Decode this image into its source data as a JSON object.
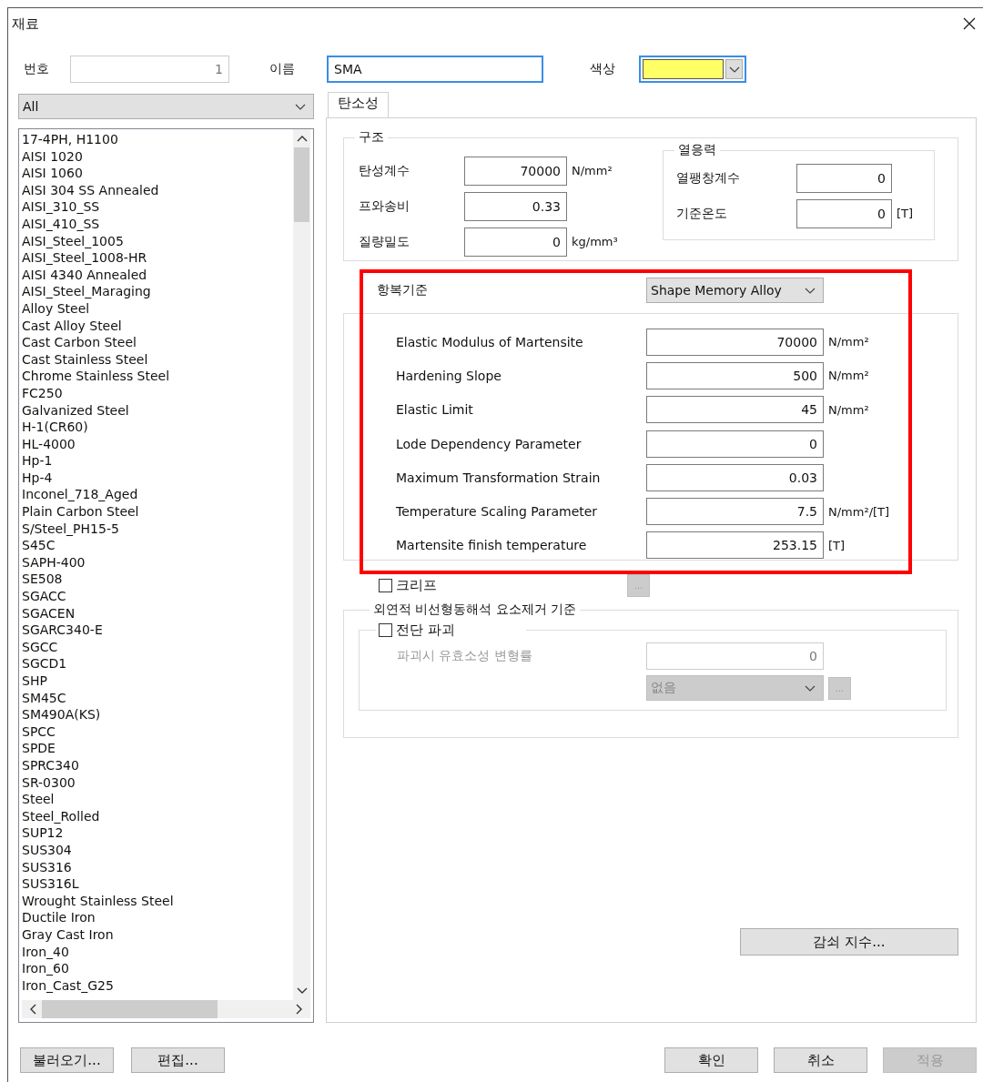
{
  "window": {
    "title": "재료"
  },
  "header": {
    "number": {
      "label": "번호",
      "value": "1",
      "disabled": true
    },
    "name": {
      "label": "이름",
      "value": "SMA",
      "focused": true
    },
    "color": {
      "label": "색상",
      "color": "#ffff66",
      "focused": true
    }
  },
  "filter": {
    "value": "All"
  },
  "materials": [
    {
      "label": "17-4PH, H1100",
      "selected": false
    },
    {
      "label": "AISI 1020",
      "selected": false
    },
    {
      "label": "AISI 1060",
      "selected": false
    },
    {
      "label": "AISI 304 SS Annealed",
      "selected": false
    },
    {
      "label": "AISI_310_SS",
      "selected": false
    },
    {
      "label": "AISI_410_SS",
      "selected": false
    },
    {
      "label": "AISI_Steel_1005",
      "selected": false
    },
    {
      "label": "AISI_Steel_1008-HR",
      "selected": false
    },
    {
      "label": "AISI 4340 Annealed",
      "selected": false
    },
    {
      "label": "AISI_Steel_Maraging",
      "selected": false
    },
    {
      "label": "Alloy Steel",
      "selected": false
    },
    {
      "label": "Cast Alloy Steel",
      "selected": false
    },
    {
      "label": "Cast Carbon Steel",
      "selected": false
    },
    {
      "label": "Cast Stainless Steel",
      "selected": false
    },
    {
      "label": "Chrome Stainless Steel",
      "selected": false
    },
    {
      "label": "FC250",
      "selected": false
    },
    {
      "label": "Galvanized Steel",
      "selected": false
    },
    {
      "label": "H-1(CR60)",
      "selected": false
    },
    {
      "label": "HL-4000",
      "selected": false
    },
    {
      "label": "Hp-1",
      "selected": false
    },
    {
      "label": "Hp-4",
      "selected": false
    },
    {
      "label": "Inconel_718_Aged",
      "selected": false
    },
    {
      "label": "Plain Carbon Steel",
      "selected": false
    },
    {
      "label": "S/Steel_PH15-5",
      "selected": false
    },
    {
      "label": "S45C",
      "selected": false
    },
    {
      "label": "SAPH-400",
      "selected": false
    },
    {
      "label": "SE508",
      "selected": false
    },
    {
      "label": "SGACC",
      "selected": false
    },
    {
      "label": "SGACEN",
      "selected": false
    },
    {
      "label": "SGARC340-E",
      "selected": false
    },
    {
      "label": "SGCC",
      "selected": false
    },
    {
      "label": "SGCD1",
      "selected": false
    },
    {
      "label": "SHP",
      "selected": false
    },
    {
      "label": "SM45C",
      "selected": false
    },
    {
      "label": "SM490A(KS)",
      "selected": false
    },
    {
      "label": "SPCC",
      "selected": false
    },
    {
      "label": "SPDE",
      "selected": false
    },
    {
      "label": "SPRC340",
      "selected": false
    },
    {
      "label": "SR-0300",
      "selected": false
    },
    {
      "label": "Steel",
      "selected": false
    },
    {
      "label": "Steel_Rolled",
      "selected": false
    },
    {
      "label": "SUP12",
      "selected": false
    },
    {
      "label": "SUS304",
      "selected": false
    },
    {
      "label": "SUS316",
      "selected": false
    },
    {
      "label": "SUS316L",
      "selected": false
    },
    {
      "label": "Wrought Stainless Steel",
      "selected": false
    },
    {
      "label": "Ductile Iron",
      "selected": false
    },
    {
      "label": "Gray Cast Iron",
      "selected": false
    },
    {
      "label": "Iron_40",
      "selected": false
    },
    {
      "label": "Iron_60",
      "selected": false
    },
    {
      "label": "Iron_Cast_G25",
      "selected": false
    }
  ],
  "tabs": [
    {
      "label": "탄소성",
      "selected": true
    }
  ],
  "structure": {
    "title": "구조",
    "fields": [
      {
        "label": "탄성계수",
        "value": "70000",
        "unit": "N/mm²"
      },
      {
        "label": "프와송비",
        "value": "0.33"
      },
      {
        "label": "질량밀도",
        "value": "0",
        "unit": "kg/mm³"
      }
    ],
    "thermal": {
      "title": "열응력",
      "fields": [
        {
          "label": "열팽창계수",
          "value": "0"
        },
        {
          "label": "기준온도",
          "value": "0",
          "unit": "[T]"
        }
      ]
    }
  },
  "yield": {
    "label": "항복기준",
    "model": "Shape Memory Alloy",
    "highlighted": true,
    "fields": [
      {
        "label": "Elastic Modulus of Martensite",
        "value": "70000",
        "unit": "N/mm²"
      },
      {
        "label": "Hardening Slope",
        "value": "500",
        "unit": "N/mm²"
      },
      {
        "label": "Elastic Limit",
        "value": "45",
        "unit": "N/mm²"
      },
      {
        "label": "Lode Dependency Parameter",
        "value": "0"
      },
      {
        "label": "Maximum Transformation Strain",
        "value": "0.03"
      },
      {
        "label": "Temperature Scaling Parameter",
        "value": "7.5",
        "unit": "N/mm²/[T]"
      },
      {
        "label": "Martensite finish temperature",
        "value": "253.15",
        "unit": "[T]"
      }
    ]
  },
  "creep": {
    "label": "크리프",
    "checked": false,
    "button": "...",
    "disabled": true
  },
  "erosion": {
    "title": "외연적 비선형동해석 요소제거 기준",
    "shear": {
      "label": "전단 파괴",
      "checked": false,
      "disabled": true,
      "strain_label": "파괴시 유효소성 변형률",
      "strain_value": "0",
      "method": "없음",
      "button": "..."
    }
  },
  "damping_button": "감쇠 지수...",
  "left_buttons": [
    {
      "label": "불러오기...",
      "disabled": false
    },
    {
      "label": "편집...",
      "disabled": false
    }
  ],
  "right_buttons": [
    {
      "label": "확인",
      "disabled": false
    },
    {
      "label": "취소",
      "disabled": false
    },
    {
      "label": "적용",
      "disabled": true
    }
  ]
}
